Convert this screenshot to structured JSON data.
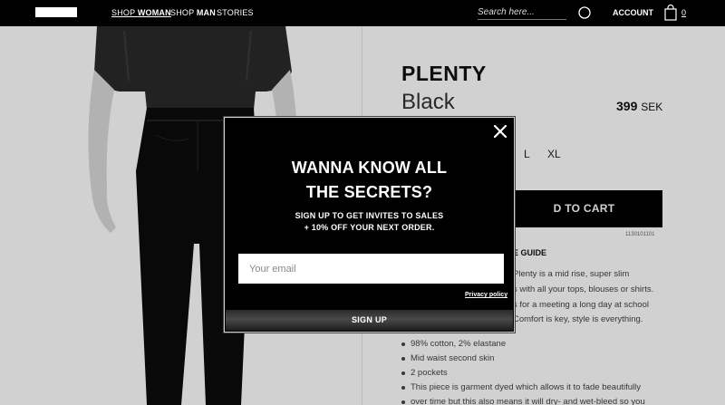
{
  "nav": {
    "links": [
      {
        "prefix": "Shop ",
        "bold": "Woman",
        "active": true
      },
      {
        "prefix": "Shop ",
        "bold": "Man",
        "active": false
      },
      {
        "prefix": "Stories",
        "bold": "",
        "active": false
      }
    ],
    "search_placeholder": "Search here...",
    "account_label": "ACCOUNT",
    "bag_count": "0"
  },
  "product": {
    "brand": "PLENTY",
    "color": "Black",
    "price_value": "399",
    "price_currency": "SEK",
    "sizes": [
      "L",
      "XL"
    ],
    "add_to_cart_partial": "D TO CART",
    "sku": "1130101101",
    "size_guide_partial": "E GUIDE",
    "description_lines": [
      "Plenty is a mid rise, super slim",
      "s with all your tops, blouses or shirts.",
      "s for a meeting a long day at school",
      "Comfort is key, style is everything."
    ],
    "bullets": [
      "98% cotton, 2% elastane",
      "Mid waist second skin",
      "2 pockets",
      "This piece is garment dyed which allows it to fade beautifully",
      "over time but this also means it will dry- and wet-bleed so you"
    ]
  },
  "modal": {
    "title_line1": "WANNA KNOW ALL",
    "title_line2": "THE SECRETS?",
    "sub_line1": "SIGN UP TO GET INVITES TO SALES",
    "sub_line2": "+ 10% OFF YOUR NEXT ORDER.",
    "email_placeholder": "Your email",
    "email_value": "",
    "privacy_label": "Privacy policy",
    "signup_label": "SIGN UP"
  },
  "colors": {
    "nav_bg": "#000000",
    "modal_bg": "#000000",
    "cart_bg": "#000000"
  },
  "icons": [
    "search-icon",
    "shopping-bag-icon",
    "close-icon"
  ]
}
